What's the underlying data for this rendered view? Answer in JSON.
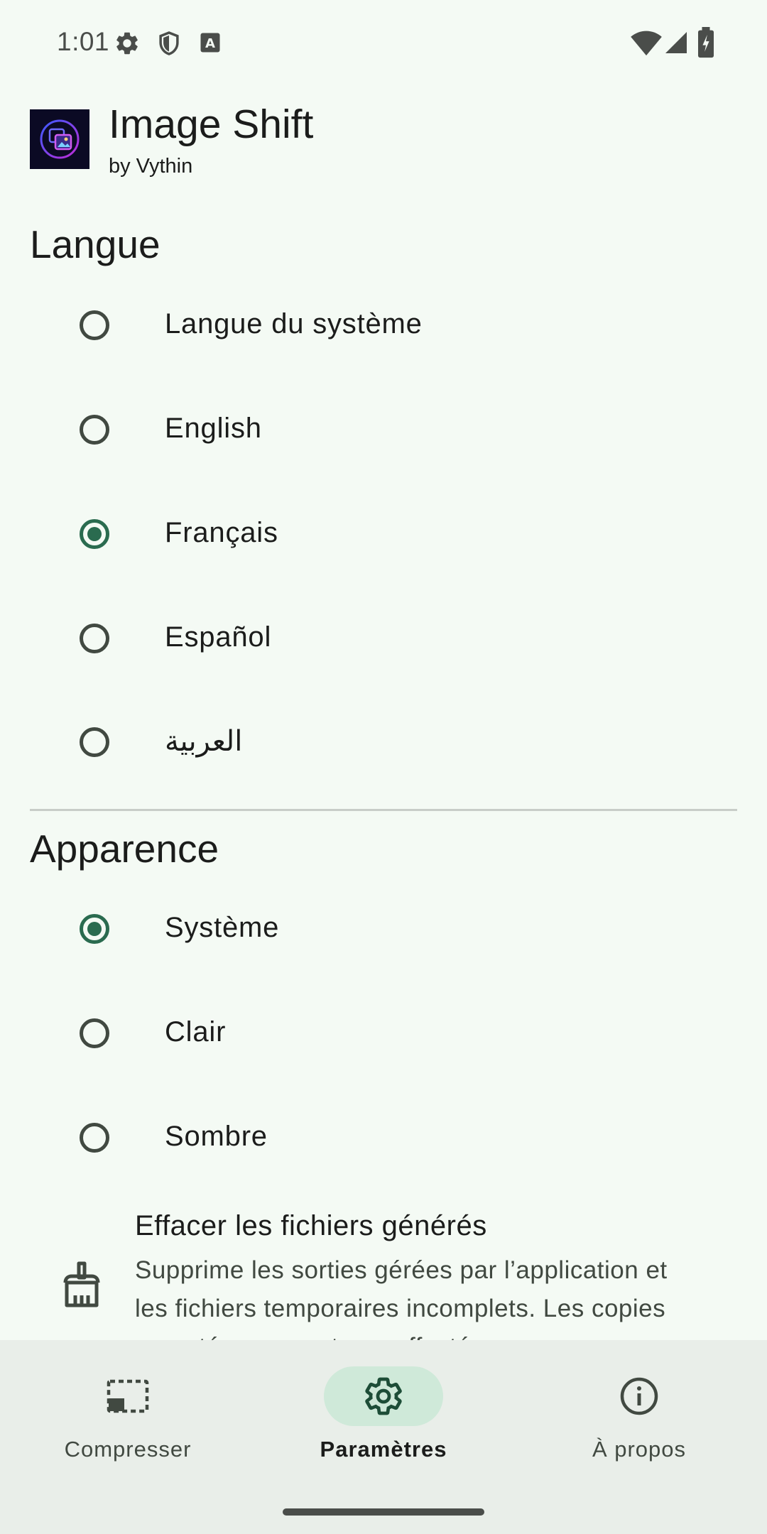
{
  "status_bar": {
    "time": "1:01",
    "icons_left": [
      "settings-icon",
      "shield-icon",
      "keyboard-a-icon"
    ],
    "icons_right": [
      "wifi-icon",
      "cellular-signal-icon",
      "battery-charging-icon"
    ]
  },
  "app": {
    "title": "Image Shift",
    "subtitle": "by Vythin"
  },
  "language_section": {
    "title": "Langue",
    "options": [
      {
        "label": "Langue du système",
        "selected": false
      },
      {
        "label": "English",
        "selected": false
      },
      {
        "label": "Français",
        "selected": true
      },
      {
        "label": "Español",
        "selected": false
      },
      {
        "label": "العربية",
        "selected": false
      }
    ]
  },
  "appearance_section": {
    "title": "Apparence",
    "options": [
      {
        "label": "Système",
        "selected": true
      },
      {
        "label": "Clair",
        "selected": false
      },
      {
        "label": "Sombre",
        "selected": false
      }
    ]
  },
  "clear_files": {
    "title": "Effacer les fichiers générés",
    "description": "Supprime les sorties gérées par l’application et les fichiers temporaires incomplets. Les copies exportées ne sont pas affectées."
  },
  "bottom_nav": {
    "items": [
      {
        "label": "Compresser",
        "icon": "compress-icon",
        "active": false
      },
      {
        "label": "Paramètres",
        "icon": "settings-icon",
        "active": true
      },
      {
        "label": "À propos",
        "icon": "info-icon",
        "active": false
      }
    ]
  },
  "colors": {
    "background": "#f4faf4",
    "accent": "#2a6b4f",
    "nav_background": "#e9eee9",
    "nav_active_pill": "#cfe9d9"
  }
}
